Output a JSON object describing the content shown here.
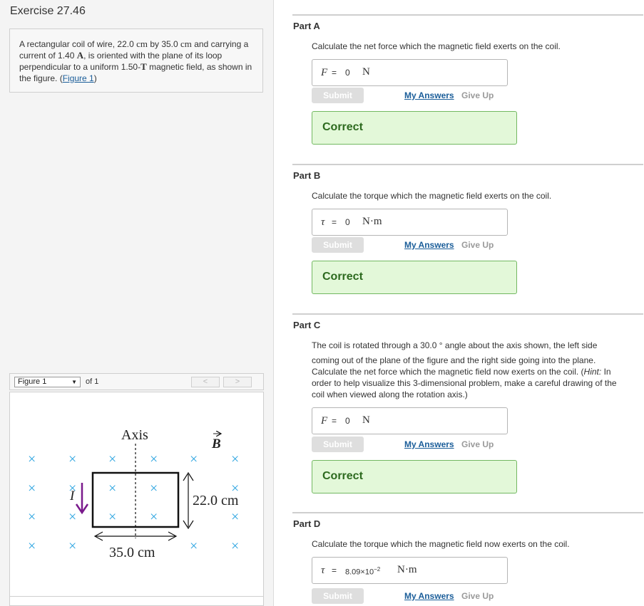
{
  "exercise": {
    "title": "Exercise 27.46"
  },
  "problem": {
    "text1": "A rectangular coil of wire, 22.0 ",
    "unit_cm_1": "cm",
    "text2": " by 35.0 ",
    "unit_cm_2": "cm",
    "text3": " and carrying a current of 1.40 ",
    "unit_A": "A",
    "text4": ", is oriented with the plane of its loop perpendicular to a uniform 1.50-",
    "unit_T": "T",
    "text5": " magnetic field, as shown in the figure. (",
    "figure_link": "Figure 1",
    "text6": ")"
  },
  "figure_bar": {
    "select_value": "Figure 1",
    "of_label": "of 1",
    "prev_label": "<",
    "next_label": ">"
  },
  "figure": {
    "axis_label": "Axis",
    "field_label": "B",
    "current_label": "I",
    "height_label": "22.0 cm",
    "width_label": "35.0 cm",
    "cross_symbol": "×"
  },
  "parts": [
    {
      "title": "Part A",
      "question": "Calculate the net force which the magnetic field exerts on the coil.",
      "symbol": "F",
      "equals": "=",
      "value": "0",
      "unit": "N",
      "submit": "Submit",
      "my_answers": "My Answers",
      "give_up": "Give Up",
      "result": "Correct"
    },
    {
      "title": "Part B",
      "question": "Calculate the torque which the magnetic field exerts on the coil.",
      "symbol": "τ",
      "equals": "=",
      "value": "0",
      "unit": "N·m",
      "submit": "Submit",
      "my_answers": "My Answers",
      "give_up": "Give Up",
      "result": "Correct"
    },
    {
      "title": "Part C",
      "question_line1": "The coil is rotated through a 30.0 ° angle about the axis shown, the left side",
      "question_line2": "coming out of the plane of the figure and the right side going into the plane.",
      "question_line3a": "Calculate the net force which the magnetic field now exerts on the coil. (",
      "hint_label": "Hint:",
      "question_line3b": " In",
      "question_line4": "order to help visualize this 3-dimensional problem, make a careful drawing of the",
      "question_line5": "coil when viewed along the rotation axis.)",
      "symbol": "F",
      "equals": "=",
      "value": "0",
      "unit": "N",
      "submit": "Submit",
      "my_answers": "My Answers",
      "give_up": "Give Up",
      "result": "Correct"
    },
    {
      "title": "Part D",
      "question": "Calculate the torque which the magnetic field now exerts on the coil.",
      "symbol": "τ",
      "equals": "=",
      "value_mantissa": "8.09×10",
      "value_exponent": "−2",
      "unit": "N·m",
      "submit": "Submit",
      "my_answers": "My Answers",
      "give_up": "Give Up"
    }
  ],
  "colors": {
    "link": "#1a5d99",
    "correct_bg": "#e3f8d9",
    "correct_border": "#72b861",
    "correct_text": "#2d6a1f",
    "cross": "#29a3e0",
    "current_arrow": "#7a1a8c"
  }
}
